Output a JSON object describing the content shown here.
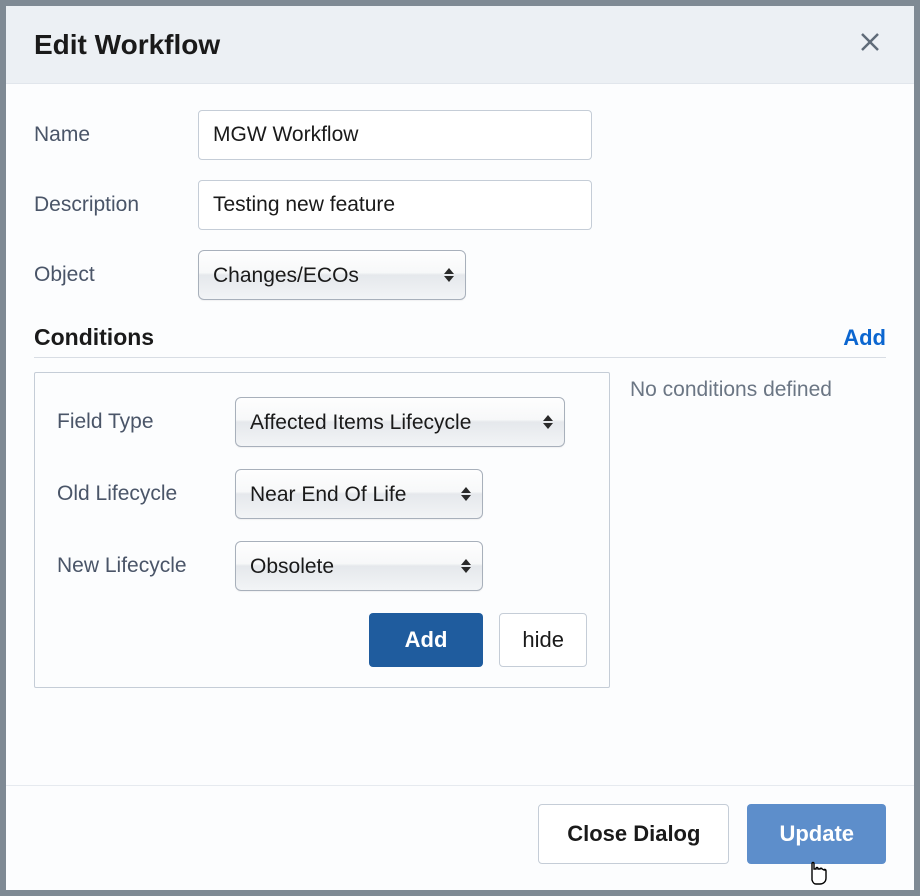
{
  "dialog": {
    "title": "Edit Workflow"
  },
  "form": {
    "name_label": "Name",
    "name_value": "MGW Workflow",
    "description_label": "Description",
    "description_value": "Testing new feature",
    "object_label": "Object",
    "object_value": "Changes/ECOs"
  },
  "conditions": {
    "title": "Conditions",
    "add_link": "Add",
    "empty": "No conditions defined",
    "panel": {
      "field_type_label": "Field Type",
      "field_type_value": "Affected Items Lifecycle",
      "old_lifecycle_label": "Old Lifecycle",
      "old_lifecycle_value": "Near End Of Life",
      "new_lifecycle_label": "New Lifecycle",
      "new_lifecycle_value": "Obsolete",
      "add_button": "Add",
      "hide_button": "hide"
    }
  },
  "footer": {
    "close": "Close Dialog",
    "update": "Update"
  }
}
